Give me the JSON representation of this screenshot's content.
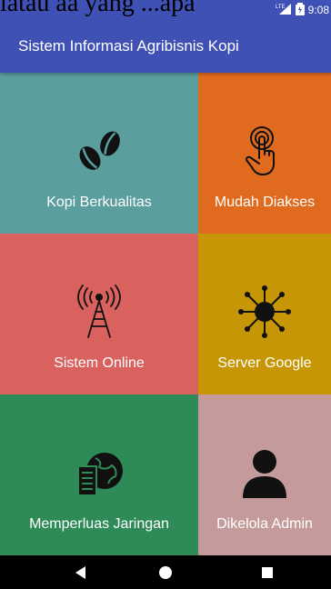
{
  "caption": {
    "text": "latau aa  yang ...apa"
  },
  "status_bar": {
    "network": "LTE",
    "time": "9:08",
    "bg": "#3f51b5"
  },
  "app_bar": {
    "title": "Sistem Informasi Agribisnis Kopi",
    "bg": "#3f51b5"
  },
  "tiles": [
    {
      "label": "Kopi Berkualitas",
      "icon": "coffee-beans-icon",
      "color": "#5b9e9e"
    },
    {
      "label": "Mudah Diakses",
      "icon": "touch-hand-icon",
      "color": "#e06a1e"
    },
    {
      "label": "Sistem Online",
      "icon": "antenna-tower-icon",
      "color": "#d9625f"
    },
    {
      "label": "Server Google",
      "icon": "network-hub-icon",
      "color": "#c79607"
    },
    {
      "label": "Memperluas Jaringan",
      "icon": "server-globe-icon",
      "color": "#2e8b57"
    },
    {
      "label": "Dikelola Admin",
      "icon": "admin-user-icon",
      "color": "#c49a9a"
    }
  ],
  "nav_bar": {
    "back": "back-icon",
    "home": "home-icon",
    "recents": "recents-icon"
  }
}
